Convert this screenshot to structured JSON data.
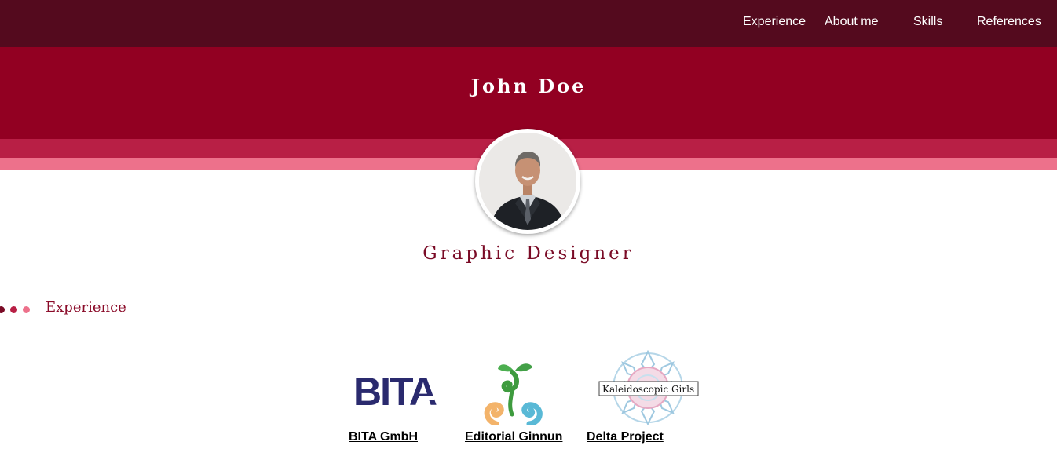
{
  "nav": {
    "items": [
      {
        "label": "Experience"
      },
      {
        "label": "About me"
      },
      {
        "label": "Skills"
      },
      {
        "label": "References"
      }
    ]
  },
  "header": {
    "name": "John Doe",
    "title": "Graphic Designer"
  },
  "profile": {
    "avatar_icon": "person-portrait"
  },
  "experience": {
    "heading": "Experience",
    "companies": [
      {
        "name": "BITA GmbH",
        "logo_text": "BITA",
        "logo_color": "#2a2a6e"
      },
      {
        "name": "Editorial Ginnun",
        "logo_icon": "sprout-spiral-logo"
      },
      {
        "name": "Delta Project",
        "logo_text": "Kaleidoscopic Girls",
        "logo_icon": "mandala-logo"
      }
    ]
  },
  "colors": {
    "nav_bg": "#540a1e",
    "hero_bg": "#920022",
    "stripe_mid": "#b81f45",
    "stripe_light": "#ed718b",
    "accent_text": "#8a0a28"
  }
}
